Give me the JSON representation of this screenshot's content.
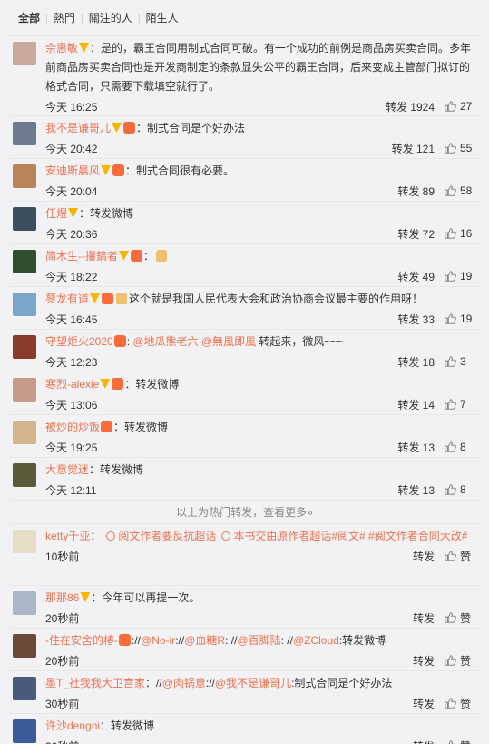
{
  "tabs": [
    "全部",
    "熱門",
    "關注的人",
    "陌生人"
  ],
  "hot_items": [
    {
      "user": "佘惠敏",
      "badges": [
        "vip"
      ],
      "content": "：是的，霸王合同用制式合同可破。有一个成功的前例是商品房买卖合同。多年前商品房买卖合同也是开发商制定的条款显失公平的霸王合同，后来变成主管部门拟订的格式合同，只需要下载填空就行了。",
      "time": "今天 16:25",
      "repost": "转发 1924",
      "likes": "27",
      "avatar": "#c9a99a"
    },
    {
      "user": "我不是谦哥儿",
      "badges": [
        "vip",
        "badge"
      ],
      "content": "：制式合同是个好办法",
      "time": "今天 20:42",
      "repost": "转发 121",
      "likes": "55",
      "avatar": "#6b7a8f"
    },
    {
      "user": "安迪斯晨风",
      "badges": [
        "vip",
        "badge"
      ],
      "content": "：制式合同很有必要。",
      "time": "今天 20:04",
      "repost": "转发 89",
      "likes": "58",
      "avatar": "#b7845c"
    },
    {
      "user": "任煜",
      "badges": [
        "vip"
      ],
      "content": "：转发微博",
      "time": "今天 20:36",
      "repost": "转发 72",
      "likes": "16",
      "avatar": "#3d4e5f"
    },
    {
      "user": "简木生--攥鎬者",
      "badges": [
        "vip",
        "badge"
      ],
      "content": "：",
      "thumb": true,
      "time": "今天 18:22",
      "repost": "转发 49",
      "likes": "19",
      "avatar": "#2f4f2f"
    },
    {
      "user": "蓼龙有道",
      "badges": [
        "vip",
        "badge"
      ],
      "content": "这个就是我国人民代表大会和政治协商会议最主要的作用呀！",
      "thumb_prefix": true,
      "time": "今天 16:45",
      "repost": "转发 33",
      "likes": "19",
      "avatar": "#7aa6c9"
    },
    {
      "user": "守望炬火2020",
      "badges": [
        "badge"
      ],
      "content_parts": [
        ": ",
        "@地瓜熊老六",
        " ",
        "@無風即風",
        " 转起来，微风~~~"
      ],
      "time": "今天 12:23",
      "repost": "转发 18",
      "likes": "3",
      "avatar": "#8a3a2a"
    },
    {
      "user": "寒烈-alexie",
      "badges": [
        "vip",
        "badge"
      ],
      "content": "：转发微博",
      "time": "今天 13:06",
      "repost": "转发 14",
      "likes": "7",
      "avatar": "#c79a8a"
    },
    {
      "user": "被炒的炒饭",
      "badges": [
        "badge"
      ],
      "content": "：转发微博",
      "time": "今天 19:25",
      "repost": "转发 13",
      "likes": "8",
      "avatar": "#d4b48c"
    },
    {
      "user": "大意觉迷",
      "badges": [],
      "content": "：转发微博",
      "time": "今天 12:11",
      "repost": "转发 13",
      "likes": "8",
      "avatar": "#5a5a3a"
    }
  ],
  "more_text": "以上为热门转发，查看更多»",
  "recent_items": [
    {
      "user": "ketty千亚",
      "content": "：",
      "topics": [
        "阅文作者要反抗超话",
        "本书交由原作者超话#阅文# #阅文作者合同大改#"
      ],
      "time": "10秒前",
      "repost": "转发",
      "likes": "赞",
      "avatar": "#e7dcc8"
    },
    {
      "user": "那那86",
      "badges": [
        "vip"
      ],
      "content": "：今年可以再提一次。",
      "time": "20秒前",
      "repost": "转发",
      "likes": "赞",
      "avatar": "#a9b7c9"
    },
    {
      "user": "-住在安舍的椿-",
      "badges": [
        "badge"
      ],
      "content_parts": [
        "://",
        "@No-ir",
        "://",
        "@血糖R",
        ": //",
        "@百脚陆",
        ": //",
        "@ZCloud",
        ":转发微博"
      ],
      "time": "20秒前",
      "repost": "转发",
      "likes": "赞",
      "avatar": "#6b4a3a"
    },
    {
      "user": "墨T_社我我大卫宫家",
      "content_parts": [
        "：//",
        "@肉锅意",
        "://",
        "@我不是谦哥儿",
        ":制式合同是个好办法"
      ],
      "time": "30秒前",
      "repost": "转发",
      "likes": "赞",
      "avatar": "#4a5a7a"
    },
    {
      "user": "许沙dengni",
      "content": "：转发微博",
      "time": "30秒前",
      "repost": "转发",
      "likes": "赞",
      "avatar": "#3a5a9a"
    }
  ],
  "colors": {
    "link": "#eb7350",
    "bg": "#f2f2f5"
  }
}
